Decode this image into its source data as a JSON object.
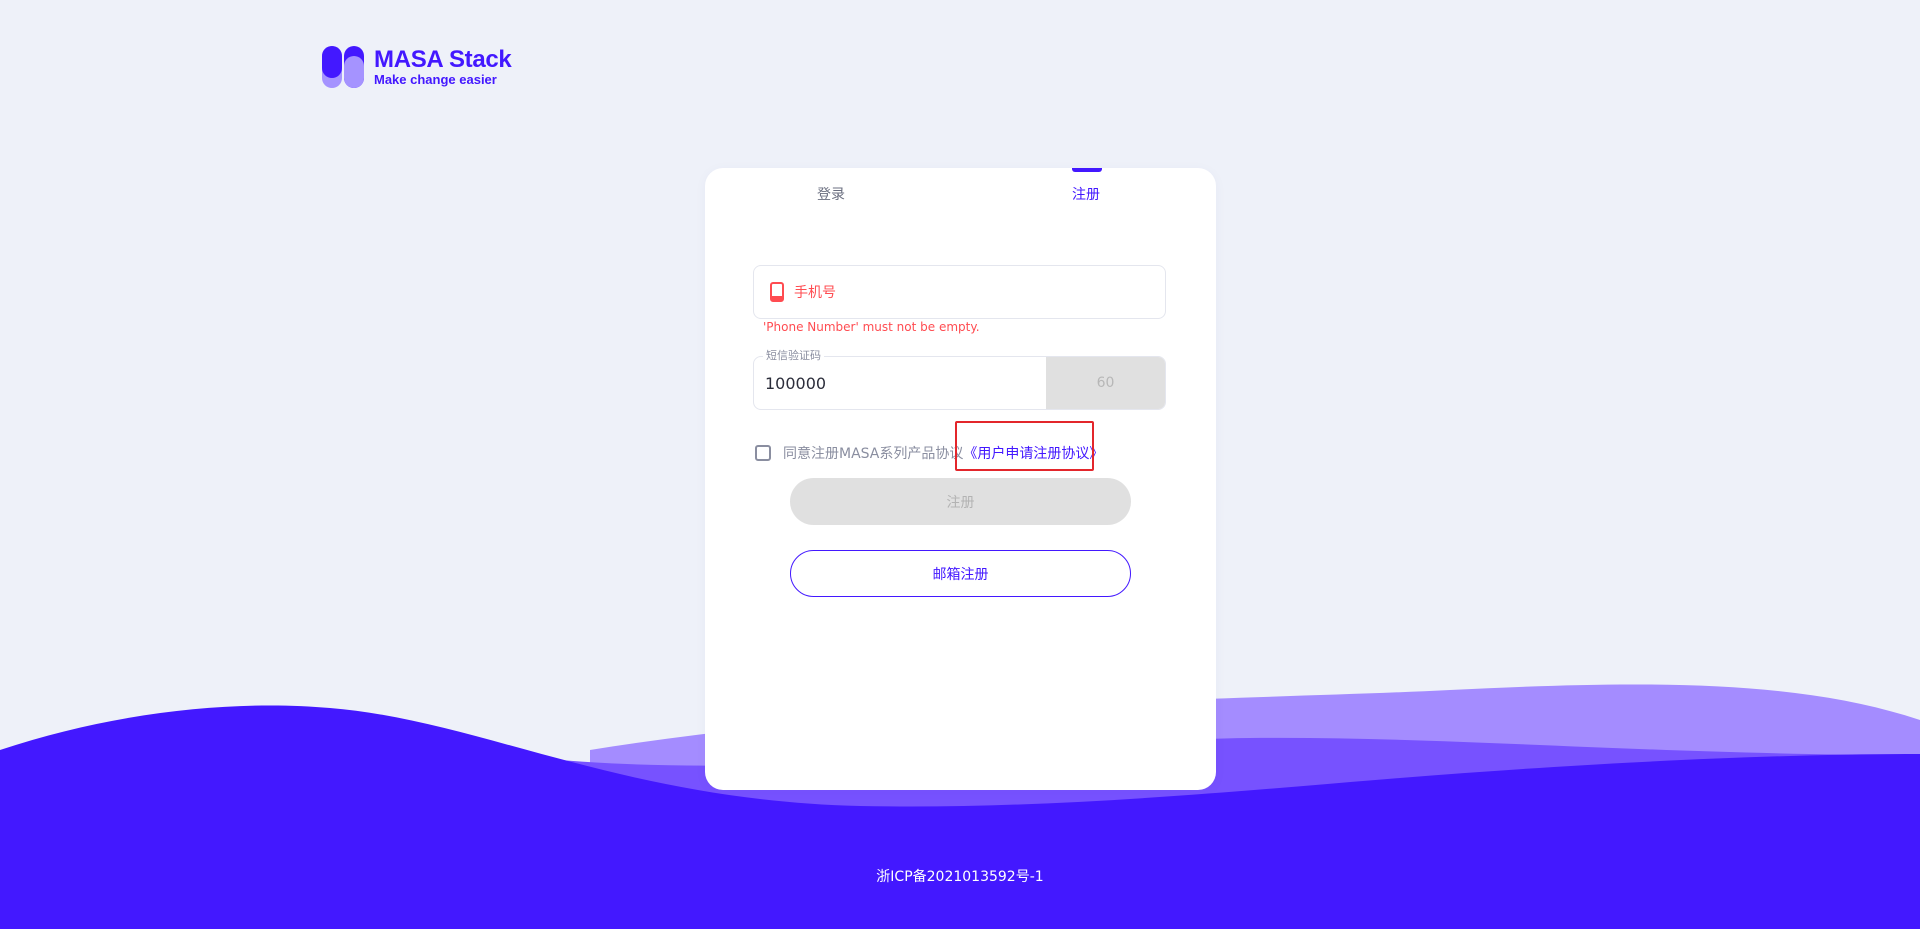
{
  "brand": {
    "title": "MASA Stack",
    "subtitle": "Make change easier",
    "primary_color": "#4318ff"
  },
  "tabs": {
    "login": "登录",
    "register": "注册",
    "active": "register"
  },
  "form": {
    "phone": {
      "placeholder": "手机号",
      "icon": "phone-icon",
      "value": "",
      "error": "'Phone Number' must not be empty."
    },
    "sms": {
      "label": "短信验证码",
      "value": "100000",
      "countdown": "60"
    },
    "agreement": {
      "text": "同意注册MASA系列产品协议",
      "link": "《用户申请注册协议》",
      "checked": false
    },
    "register_button": "注册",
    "email_register_button": "邮箱注册"
  },
  "footer": {
    "icp": "浙ICP备2021013592号-1"
  }
}
